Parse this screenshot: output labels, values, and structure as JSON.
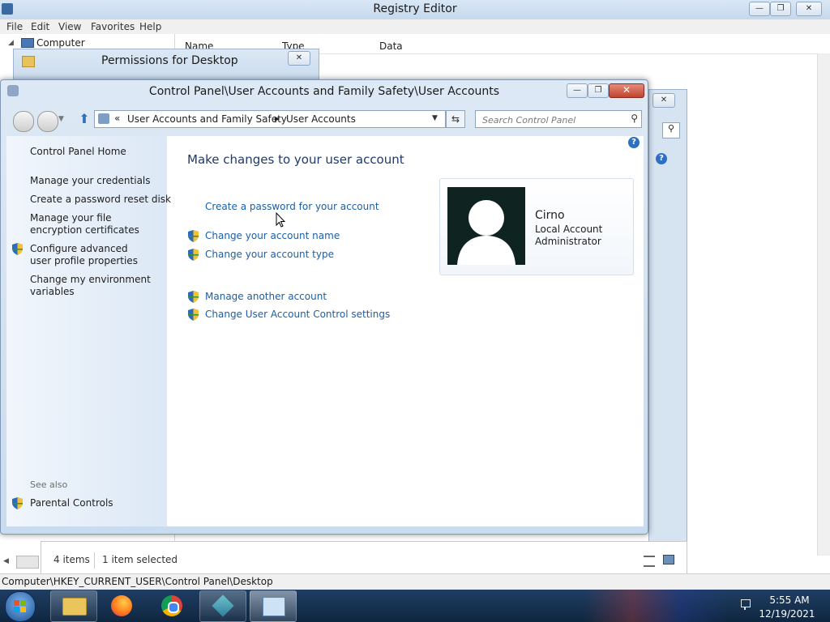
{
  "registry": {
    "title": "Registry Editor",
    "menu": [
      "File",
      "Edit",
      "View",
      "Favorites",
      "Help"
    ],
    "tree_root": "Computer",
    "columns": [
      "Name",
      "Type",
      "Data"
    ],
    "status_path": "Computer\\HKEY_CURRENT_USER\\Control Panel\\Desktop"
  },
  "permissions_dialog": {
    "title": "Permissions for Desktop"
  },
  "explorer_status": {
    "items_count": "4 items",
    "items_selected": "1 item selected"
  },
  "control_panel": {
    "title": "Control Panel\\User Accounts and Family Safety\\User Accounts",
    "address": {
      "chevron": "«",
      "crumb1": "User Accounts and Family Safety",
      "separator": "▶",
      "crumb2": "User Accounts"
    },
    "search_placeholder": "Search Control Panel",
    "left_pane": {
      "home": "Control Panel Home",
      "links": [
        "Manage your credentials",
        "Create a password reset disk",
        "Manage your file encryption certificates",
        "Configure advanced user profile properties",
        "Change my environment variables"
      ],
      "see_also": "See also",
      "parental_controls": "Parental Controls"
    },
    "main": {
      "heading": "Make changes to your user account",
      "links": [
        "Create a password for your account",
        "Change your account name",
        "Change your account type",
        "Manage another account",
        "Change User Account Control settings"
      ]
    },
    "user": {
      "name": "Cirno",
      "account_type": "Local Account",
      "role": "Administrator"
    }
  },
  "taskbar": {
    "time": "5:55 AM",
    "date": "12/19/2021"
  },
  "icons": {
    "shield": "uac-shield-icon",
    "help": "help-icon",
    "search": "search-icon",
    "up": "up-arrow-icon",
    "refresh": "refresh-icon"
  },
  "colors": {
    "link": "#1b5fa8",
    "heading": "#1e3a6b",
    "taskbar": "#1f3e63",
    "close_button": "#c2432e"
  }
}
